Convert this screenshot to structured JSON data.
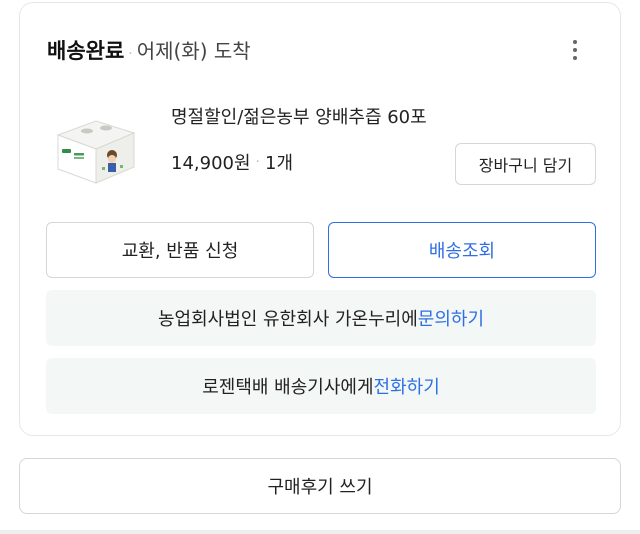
{
  "order": {
    "status": "배송완료",
    "separator": "·",
    "delivery_date": "어제(화) 도착",
    "more_icon": "more-vertical-icon"
  },
  "product": {
    "name": "명절할인/젊은농부 양배추즙 60포",
    "price": "14,900원",
    "separator": "·",
    "quantity": "1개",
    "thumbnail_icon": "product-box-image"
  },
  "buttons": {
    "cart": "장바구니 담기",
    "return": "교환, 반품 신청",
    "track": "배송조회",
    "review": "구매후기 쓰기"
  },
  "inquiry": {
    "prefix": "농업회사법인 유한회사 가온누리에 ",
    "link": "문의하기"
  },
  "courier": {
    "prefix": "로젠택배 배송기사에게 ",
    "link": "전화하기"
  },
  "colors": {
    "accent": "#2f6fe4",
    "info_bg": "#f3f7f5",
    "border": "#d4d6da"
  }
}
